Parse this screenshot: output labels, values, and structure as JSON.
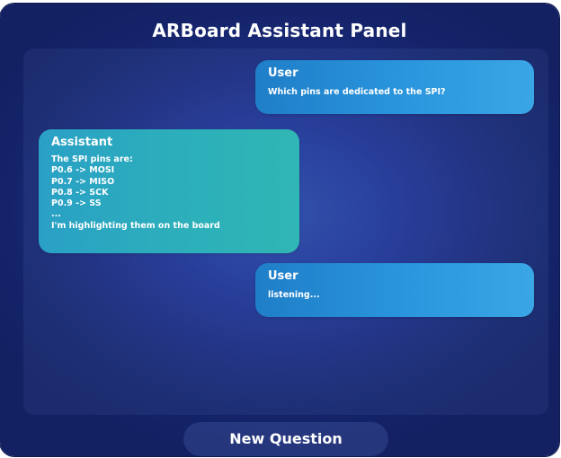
{
  "panel": {
    "title": "ARBoard Assistant Panel"
  },
  "messages": [
    {
      "sender": "User",
      "text": "Which pins are dedicated to the SPI?"
    },
    {
      "sender": "Assistant",
      "text": "The SPI pins are:\nP0.6 -> MOSI\nP0.7 -> MISO\nP0.8 -> SCK\nP0.9 -> SS\n...\nI'm highlighting them on the board"
    },
    {
      "sender": "User",
      "text": "listening..."
    }
  ],
  "actions": {
    "new_question_label": "New Question"
  },
  "colors": {
    "panel_background": "#1b2c80",
    "user_bubble": "#2a96dd",
    "assistant_bubble": "#2cafba",
    "text": "#ffffff"
  }
}
